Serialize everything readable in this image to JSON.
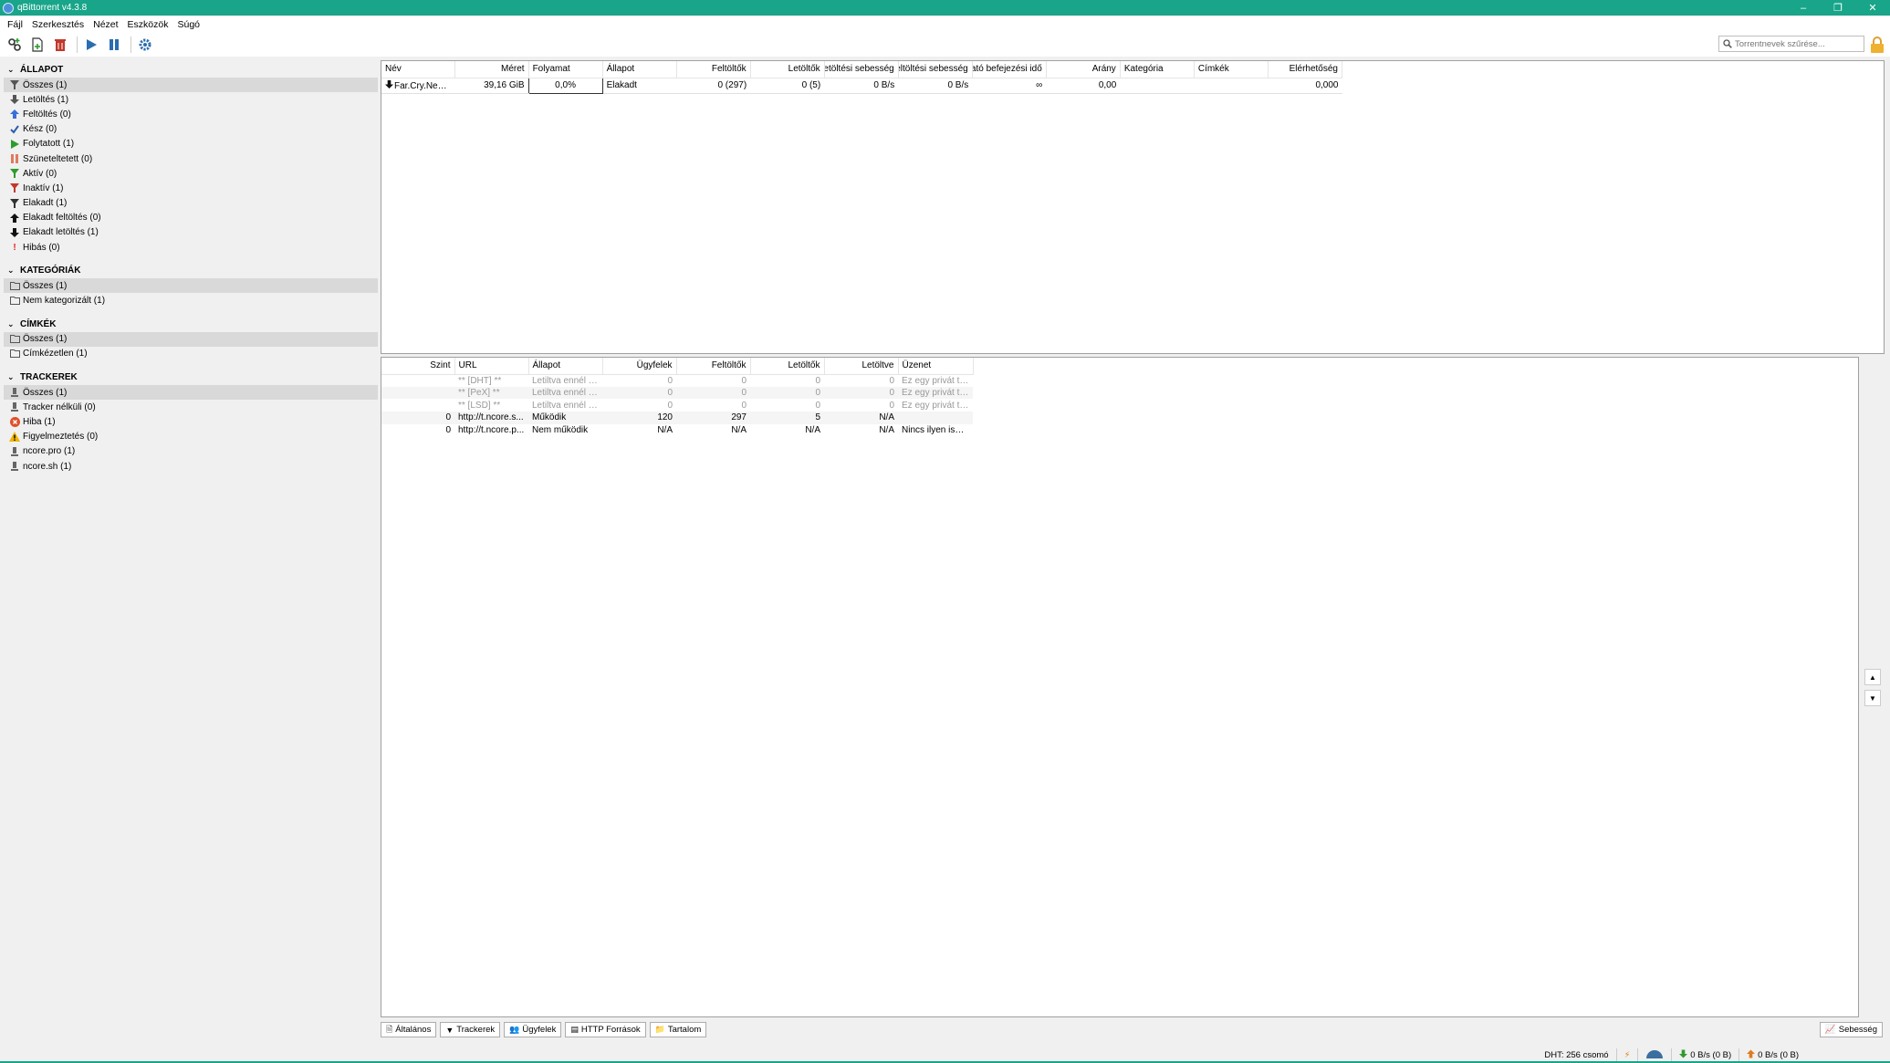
{
  "window": {
    "title": "qBittorrent v4.3.8"
  },
  "menu": [
    "Fájl",
    "Szerkesztés",
    "Nézet",
    "Eszközök",
    "Súgó"
  ],
  "search": {
    "placeholder": "Torrentnevek szűrése..."
  },
  "sidebar": {
    "status": {
      "title": "ÁLLAPOT",
      "items": [
        {
          "label": "Összes (1)",
          "icon": "filter-icon",
          "color": "#555"
        },
        {
          "label": "Letöltés (1)",
          "icon": "download-arrow-icon",
          "color": "#555"
        },
        {
          "label": "Feltöltés (0)",
          "icon": "upload-arrow-icon",
          "color": "#3a6fd8"
        },
        {
          "label": "Kész (0)",
          "icon": "check-icon",
          "color": "#2a5db0"
        },
        {
          "label": "Folytatott (1)",
          "icon": "play-icon",
          "color": "#2e9b2e"
        },
        {
          "label": "Szüneteltetett (0)",
          "icon": "pause-icon",
          "color": "#e07a5f"
        },
        {
          "label": "Aktív (0)",
          "icon": "filter-icon",
          "color": "#2e9b2e"
        },
        {
          "label": "Inaktív (1)",
          "icon": "filter-icon",
          "color": "#c0392b"
        },
        {
          "label": "Elakadt (1)",
          "icon": "filter-icon",
          "color": "#333"
        },
        {
          "label": "Elakadt feltöltés (0)",
          "icon": "upload-arrow-icon",
          "color": "#111"
        },
        {
          "label": "Elakadt letöltés (1)",
          "icon": "download-arrow-icon",
          "color": "#111"
        },
        {
          "label": "Hibás (0)",
          "icon": "exclamation-icon",
          "color": "#e02020"
        }
      ]
    },
    "categories": {
      "title": "KATEGÓRIÁK",
      "items": [
        {
          "label": "Összes (1)"
        },
        {
          "label": "Nem kategorizált (1)"
        }
      ]
    },
    "tags": {
      "title": "CÍMKÉK",
      "items": [
        {
          "label": "Összes (1)"
        },
        {
          "label": "Címkézetlen (1)"
        }
      ]
    },
    "trackers": {
      "title": "TRACKEREK",
      "items": [
        {
          "label": "Összes (1)",
          "icon": "tracker-icon"
        },
        {
          "label": "Tracker nélküli (0)",
          "icon": "tracker-icon"
        },
        {
          "label": "Hiba (1)",
          "icon": "error-icon"
        },
        {
          "label": "Figyelmeztetés (0)",
          "icon": "warning-icon"
        },
        {
          "label": "ncore.pro (1)",
          "icon": "tracker-icon"
        },
        {
          "label": "ncore.sh (1)",
          "icon": "tracker-icon"
        }
      ]
    }
  },
  "torrents": {
    "columns": [
      "Név",
      "Méret",
      "Folyamat",
      "Állapot",
      "Feltöltők",
      "Letöltők",
      "Letöltési sebesség",
      "Feltöltési sebesség",
      "Várható befejezési idő",
      "Arány",
      "Kategória",
      "Címkék",
      "Elérhetőség"
    ],
    "rows": [
      {
        "name": "Far.Cry.New...",
        "size": "39,16 GiB",
        "progress": "0,0%",
        "state": "Elakadt",
        "seeds": "0 (297)",
        "peers": "0 (5)",
        "dl": "0 B/s",
        "ul": "0 B/s",
        "eta": "∞",
        "ratio": "0,00",
        "category": "",
        "tags": "",
        "availability": "0,000"
      }
    ]
  },
  "trackers": {
    "columns": [
      "Szint",
      "URL",
      "Állapot",
      "Ügyfelek",
      "Feltöltők",
      "Letöltők",
      "Letöltve",
      "Üzenet"
    ],
    "rows": [
      {
        "tier": "",
        "url": "** [DHT] **",
        "status": "Letiltva ennél a ...",
        "peers": "0",
        "seeds": "0",
        "leeches": "0",
        "downloaded": "0",
        "msg": "Ez egy privát tor...",
        "grey": true
      },
      {
        "tier": "",
        "url": "** [PeX] **",
        "status": "Letiltva ennél a ...",
        "peers": "0",
        "seeds": "0",
        "leeches": "0",
        "downloaded": "0",
        "msg": "Ez egy privát tor...",
        "grey": true
      },
      {
        "tier": "",
        "url": "** [LSD] **",
        "status": "Letiltva ennél a ...",
        "peers": "0",
        "seeds": "0",
        "leeches": "0",
        "downloaded": "0",
        "msg": "Ez egy privát tor...",
        "grey": true
      },
      {
        "tier": "0",
        "url": "http://t.ncore.s...",
        "status": "Működik",
        "peers": "120",
        "seeds": "297",
        "leeches": "5",
        "downloaded": "N/A",
        "msg": "",
        "grey": false
      },
      {
        "tier": "0",
        "url": "http://t.ncore.p...",
        "status": "Nem működik",
        "peers": "N/A",
        "seeds": "N/A",
        "leeches": "N/A",
        "downloaded": "N/A",
        "msg": "Nincs ilyen ism...",
        "grey": false
      }
    ]
  },
  "tabs": [
    "Általános",
    "Trackerek",
    "Ügyfelek",
    "HTTP Források",
    "Tartalom"
  ],
  "speed_tab": "Sebesség",
  "status": {
    "dht": "DHT: 256 csomó",
    "download": "0 B/s (0 B)",
    "upload": "0 B/s (0 B)"
  },
  "colors": {
    "titlebar": "#18a589"
  }
}
